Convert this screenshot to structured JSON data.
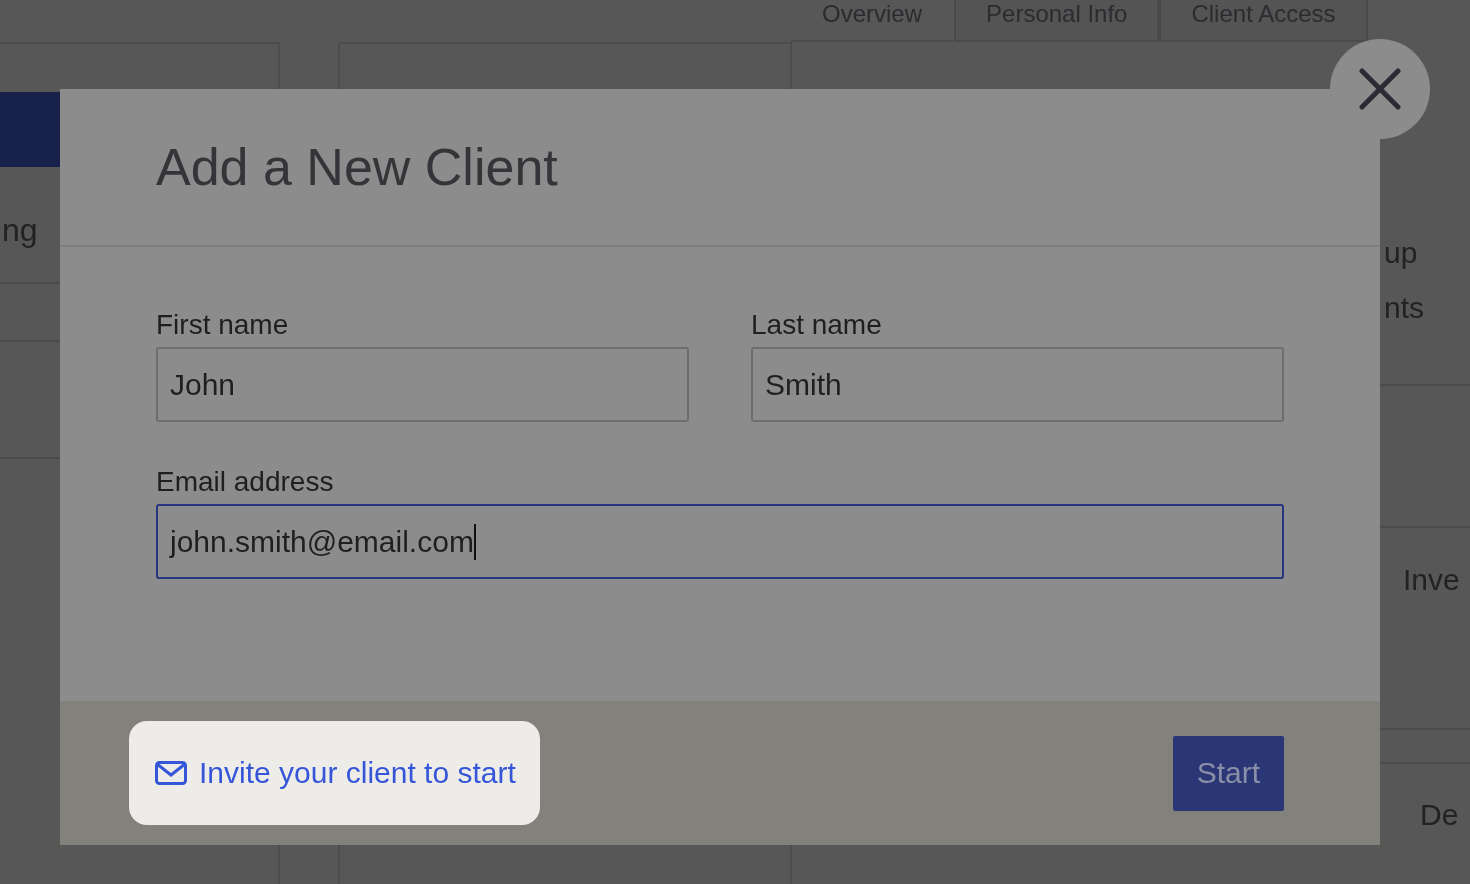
{
  "background": {
    "tabs": [
      {
        "label": "Overview",
        "selected": true
      },
      {
        "label": "Personal Info",
        "selected": false
      },
      {
        "label": "Client Access",
        "selected": false
      }
    ],
    "left_text": "ng",
    "right_texts": [
      "up",
      "nts",
      "Inve",
      "De"
    ]
  },
  "dialog": {
    "title": "Add a New Client",
    "fields": [
      {
        "label": "First name",
        "value": "John",
        "focused": false
      },
      {
        "label": "Last name",
        "value": "Smith",
        "focused": false
      },
      {
        "label": "Email address",
        "value": "john.smith@email.com",
        "focused": true
      }
    ],
    "invite_link": "Invite your client to start",
    "start_button": "Start"
  }
}
